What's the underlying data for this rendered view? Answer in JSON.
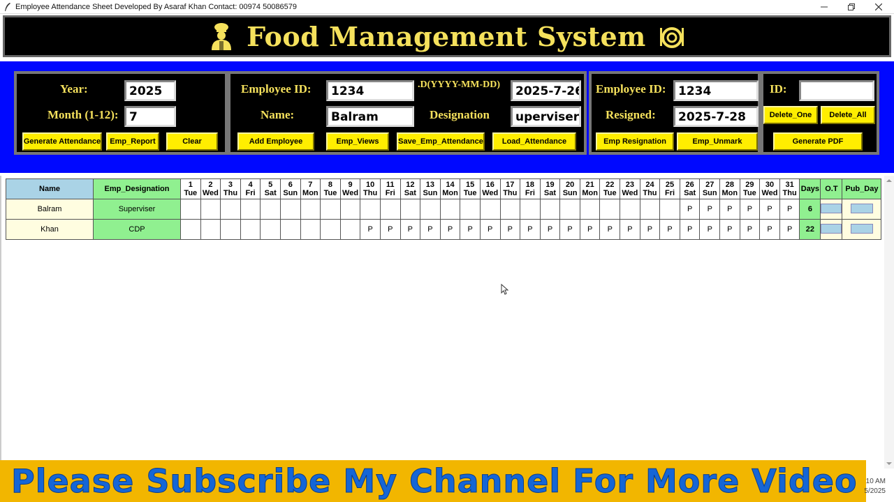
{
  "window": {
    "title": "Employee Attendance Sheet Developed By Asaraf Khan Contact: 00974 50086579",
    "minimize": "—",
    "maximize": "❐",
    "close": "✕"
  },
  "header": {
    "title": "Food Management System",
    "left_icon": "chef-icon",
    "right_icon": "plate-icon"
  },
  "panel1": {
    "year_label": "Year:",
    "year_value": "2025",
    "month_label": "Month (1-12):",
    "month_value": "7",
    "btn_generate": "Generate Attendance",
    "btn_report": "Emp_Report",
    "btn_clear": "Clear"
  },
  "panel2": {
    "empid_label": "Employee ID:",
    "empid_value": "1234",
    "date_label": ".D(YYYY-MM-DD)",
    "date_value": "2025-7-26",
    "name_label": "Name:",
    "name_value": "Balram",
    "designation_label": "Designation",
    "designation_value": "uperviser",
    "btn_add": "Add Employee",
    "btn_views": "Emp_Views",
    "btn_save": "Save_Emp_Attendance",
    "btn_load": "Load_Attendance"
  },
  "panel3": {
    "empid_label": "Employee ID:",
    "empid_value": "1234",
    "resigned_label": "Resigned:",
    "resigned_value": "2025-7-28",
    "btn_resign": "Emp Resignation",
    "btn_unmark": "Emp_Unmark"
  },
  "panel4": {
    "id_label": "ID:",
    "id_value": "",
    "btn_delete_one": "Delete_One",
    "btn_delete_all": "Delete_All",
    "btn_pdf": "Generate PDF"
  },
  "table": {
    "col_name": "Name",
    "col_designation": "Emp_Designation",
    "col_days": "Days",
    "col_ot": "O.T",
    "col_pubday": "Pub_Day",
    "days": [
      {
        "num": "1",
        "dow": "Tue"
      },
      {
        "num": "2",
        "dow": "Wed"
      },
      {
        "num": "3",
        "dow": "Thu"
      },
      {
        "num": "4",
        "dow": "Fri"
      },
      {
        "num": "5",
        "dow": "Sat"
      },
      {
        "num": "6",
        "dow": "Sun"
      },
      {
        "num": "7",
        "dow": "Mon"
      },
      {
        "num": "8",
        "dow": "Tue"
      },
      {
        "num": "9",
        "dow": "Wed"
      },
      {
        "num": "10",
        "dow": "Thu"
      },
      {
        "num": "11",
        "dow": "Fri"
      },
      {
        "num": "12",
        "dow": "Sat"
      },
      {
        "num": "13",
        "dow": "Sun"
      },
      {
        "num": "14",
        "dow": "Mon"
      },
      {
        "num": "15",
        "dow": "Tue"
      },
      {
        "num": "16",
        "dow": "Wed"
      },
      {
        "num": "17",
        "dow": "Thu"
      },
      {
        "num": "18",
        "dow": "Fri"
      },
      {
        "num": "19",
        "dow": "Sat"
      },
      {
        "num": "20",
        "dow": "Sun"
      },
      {
        "num": "21",
        "dow": "Mon"
      },
      {
        "num": "22",
        "dow": "Tue"
      },
      {
        "num": "23",
        "dow": "Wed"
      },
      {
        "num": "24",
        "dow": "Thu"
      },
      {
        "num": "25",
        "dow": "Fri"
      },
      {
        "num": "26",
        "dow": "Sat"
      },
      {
        "num": "27",
        "dow": "Sun"
      },
      {
        "num": "28",
        "dow": "Mon"
      },
      {
        "num": "29",
        "dow": "Tue"
      },
      {
        "num": "30",
        "dow": "Wed"
      },
      {
        "num": "31",
        "dow": "Thu"
      }
    ],
    "rows": [
      {
        "name": "Balram",
        "designation": "Superviser",
        "marks": [
          "",
          "",
          "",
          "",
          "",
          "",
          "",
          "",
          "",
          "",
          "",
          "",
          "",
          "",
          "",
          "",
          "",
          "",
          "",
          "",
          "",
          "",
          "",
          "",
          "",
          "P",
          "P",
          "P",
          "P",
          "P",
          "P"
        ],
        "days": "6"
      },
      {
        "name": "Khan",
        "designation": "CDP",
        "marks": [
          "",
          "",
          "",
          "",
          "",
          "",
          "",
          "",
          "",
          "P",
          "P",
          "P",
          "P",
          "P",
          "P",
          "P",
          "P",
          "P",
          "P",
          "P",
          "P",
          "P",
          "P",
          "P",
          "P",
          "P",
          "P",
          "P",
          "P",
          "P",
          "P"
        ],
        "days": "22"
      }
    ]
  },
  "banner": {
    "text": "Please Subscribe My Channel For More Video"
  },
  "clock": {
    "time": "10 AM",
    "date": "5/2025"
  }
}
